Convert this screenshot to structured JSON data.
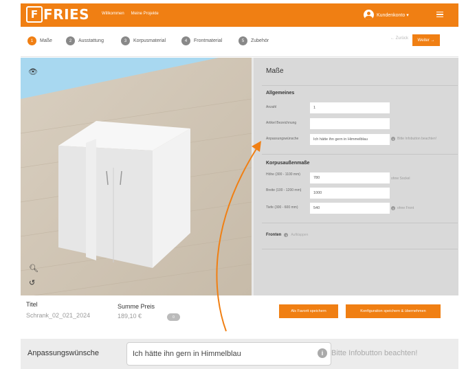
{
  "header": {
    "logo_letter": "F",
    "logo_text": "FRIES",
    "nav": [
      "Willkommen",
      "Meine Projekte"
    ],
    "account_label": "Kundenkonto ▾"
  },
  "steps": [
    {
      "num": "1",
      "label": "Maße"
    },
    {
      "num": "2",
      "label": "Ausstattung"
    },
    {
      "num": "3",
      "label": "Korpusmaterial"
    },
    {
      "num": "4",
      "label": "Frontmaterial"
    },
    {
      "num": "5",
      "label": "Zubehör"
    }
  ],
  "actions": {
    "back": "← Zurück",
    "next": "Weiter →"
  },
  "panel": {
    "title": "Maße",
    "general": {
      "title": "Allgemeines",
      "fields": [
        {
          "label": "Anzahl",
          "value": "1",
          "note": ""
        },
        {
          "label": "Artikel Bezeichnung",
          "value": "",
          "note": ""
        },
        {
          "label": "Anpassungswünsche",
          "value": "Ich hätte ihn gern in Himmelblau",
          "note": "Bitte Infobutton beachten!"
        }
      ]
    },
    "outer": {
      "title": "Korpusaußenmaße",
      "fields": [
        {
          "label": "Höhe (300 - 1100 mm)",
          "value": "780",
          "note": "ohne Sockel"
        },
        {
          "label": "Breite (100 - 1200 mm)",
          "value": "1000",
          "note": ""
        },
        {
          "label": "Tiefe (300 - 600 mm)",
          "value": "540",
          "note": "ohne Front"
        }
      ]
    },
    "fronten": {
      "label": "Fronten",
      "info": "i",
      "state": "Aufklappen"
    }
  },
  "footer": {
    "title_label": "Titel",
    "title_value": "Schrank_02_021_2024",
    "price_label": "Summe Preis",
    "price_value": "189,10 €",
    "cart_count": "0",
    "btn_save": "Als Favorit speichern",
    "btn_save_apply": "Konfiguration speichern & übernehmen"
  },
  "zoom": {
    "label": "Anpassungswünsche",
    "value": "Ich hätte ihn gern in Himmelblau",
    "note": "Bitte Infobutton beachten!",
    "info": "i"
  },
  "colors": {
    "accent": "#f07f13",
    "panel": "#d9d9d9",
    "sky": "#a8d8f0"
  },
  "icons": [
    "eye-icon",
    "zoom-icon",
    "undo-icon",
    "info-icon",
    "menu-icon",
    "user-icon"
  ]
}
